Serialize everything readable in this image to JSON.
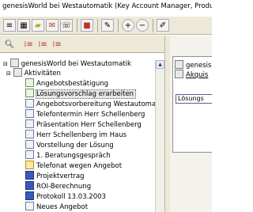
{
  "window": {
    "title": "genesisWorld bei Westautomatik (Key Account Manager, Produktmar"
  },
  "toolbar": {
    "icons": [
      "list-icon",
      "grid-icon",
      "folder-open-icon",
      "mail-icon",
      "phone-icon",
      "red-book-icon",
      "edit-icon",
      "plus-icon",
      "minus-icon",
      "note-icon"
    ]
  },
  "tree": {
    "root_label": "genesisWorld bei Westautomatik",
    "group_label": "Aktivitäten",
    "items": [
      {
        "label": "Angebotsbestätigung",
        "icon": "check-icon"
      },
      {
        "label": "Lösungsvorschlag erarbeiten",
        "icon": "check-icon",
        "selected": true
      },
      {
        "label": "Angebotsvorbereitung Westautomatik",
        "icon": "doc-icon"
      },
      {
        "label": "Telefontermin Herr Schellenberg",
        "icon": "doc-icon"
      },
      {
        "label": "Präsentation Herr Schellenberg",
        "icon": "doc-icon"
      },
      {
        "label": "Herr Schellenberg im Haus",
        "icon": "doc-icon"
      },
      {
        "label": "Vorstellung der Lösung",
        "icon": "doc-icon"
      },
      {
        "label": "1. Beratungsgespräch",
        "icon": "doc-icon"
      },
      {
        "label": "Telefonat wegen Angebot",
        "icon": "phone-doc-icon"
      },
      {
        "label": "Projektvertrag",
        "icon": "word-doc-icon"
      },
      {
        "label": "ROI-Berechnung",
        "icon": "word-doc-icon"
      },
      {
        "label": "Protokoll 13.03.2003",
        "icon": "word-doc-icon"
      },
      {
        "label": "Neues Angebot",
        "icon": "doc-icon"
      }
    ]
  },
  "right_pane": {
    "row1": "genesis",
    "row2": "Akquis",
    "tab_label": "Lösungs"
  }
}
